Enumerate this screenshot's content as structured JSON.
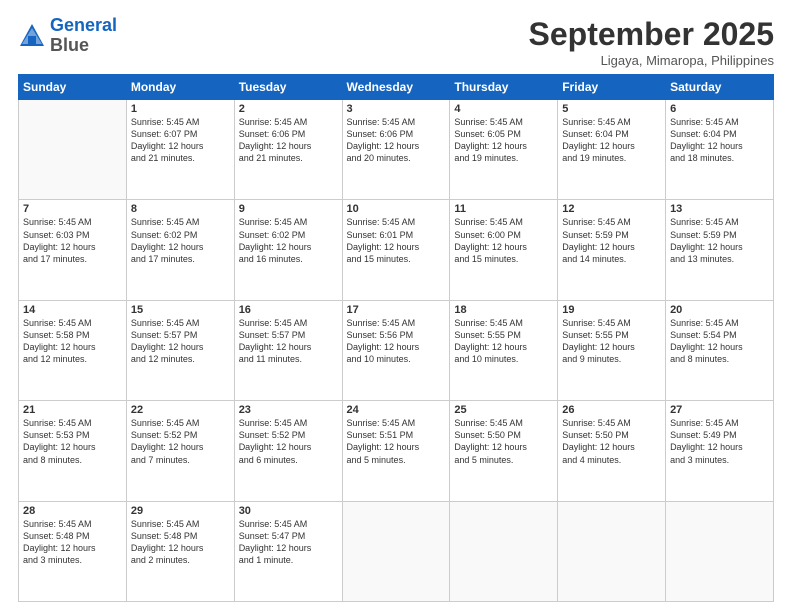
{
  "logo": {
    "line1": "General",
    "line2": "Blue"
  },
  "title": "September 2025",
  "location": "Ligaya, Mimaropa, Philippines",
  "days_of_week": [
    "Sunday",
    "Monday",
    "Tuesday",
    "Wednesday",
    "Thursday",
    "Friday",
    "Saturday"
  ],
  "weeks": [
    [
      {
        "day": "",
        "text": ""
      },
      {
        "day": "1",
        "text": "Sunrise: 5:45 AM\nSunset: 6:07 PM\nDaylight: 12 hours\nand 21 minutes."
      },
      {
        "day": "2",
        "text": "Sunrise: 5:45 AM\nSunset: 6:06 PM\nDaylight: 12 hours\nand 21 minutes."
      },
      {
        "day": "3",
        "text": "Sunrise: 5:45 AM\nSunset: 6:06 PM\nDaylight: 12 hours\nand 20 minutes."
      },
      {
        "day": "4",
        "text": "Sunrise: 5:45 AM\nSunset: 6:05 PM\nDaylight: 12 hours\nand 19 minutes."
      },
      {
        "day": "5",
        "text": "Sunrise: 5:45 AM\nSunset: 6:04 PM\nDaylight: 12 hours\nand 19 minutes."
      },
      {
        "day": "6",
        "text": "Sunrise: 5:45 AM\nSunset: 6:04 PM\nDaylight: 12 hours\nand 18 minutes."
      }
    ],
    [
      {
        "day": "7",
        "text": "Sunrise: 5:45 AM\nSunset: 6:03 PM\nDaylight: 12 hours\nand 17 minutes."
      },
      {
        "day": "8",
        "text": "Sunrise: 5:45 AM\nSunset: 6:02 PM\nDaylight: 12 hours\nand 17 minutes."
      },
      {
        "day": "9",
        "text": "Sunrise: 5:45 AM\nSunset: 6:02 PM\nDaylight: 12 hours\nand 16 minutes."
      },
      {
        "day": "10",
        "text": "Sunrise: 5:45 AM\nSunset: 6:01 PM\nDaylight: 12 hours\nand 15 minutes."
      },
      {
        "day": "11",
        "text": "Sunrise: 5:45 AM\nSunset: 6:00 PM\nDaylight: 12 hours\nand 15 minutes."
      },
      {
        "day": "12",
        "text": "Sunrise: 5:45 AM\nSunset: 5:59 PM\nDaylight: 12 hours\nand 14 minutes."
      },
      {
        "day": "13",
        "text": "Sunrise: 5:45 AM\nSunset: 5:59 PM\nDaylight: 12 hours\nand 13 minutes."
      }
    ],
    [
      {
        "day": "14",
        "text": "Sunrise: 5:45 AM\nSunset: 5:58 PM\nDaylight: 12 hours\nand 12 minutes."
      },
      {
        "day": "15",
        "text": "Sunrise: 5:45 AM\nSunset: 5:57 PM\nDaylight: 12 hours\nand 12 minutes."
      },
      {
        "day": "16",
        "text": "Sunrise: 5:45 AM\nSunset: 5:57 PM\nDaylight: 12 hours\nand 11 minutes."
      },
      {
        "day": "17",
        "text": "Sunrise: 5:45 AM\nSunset: 5:56 PM\nDaylight: 12 hours\nand 10 minutes."
      },
      {
        "day": "18",
        "text": "Sunrise: 5:45 AM\nSunset: 5:55 PM\nDaylight: 12 hours\nand 10 minutes."
      },
      {
        "day": "19",
        "text": "Sunrise: 5:45 AM\nSunset: 5:55 PM\nDaylight: 12 hours\nand 9 minutes."
      },
      {
        "day": "20",
        "text": "Sunrise: 5:45 AM\nSunset: 5:54 PM\nDaylight: 12 hours\nand 8 minutes."
      }
    ],
    [
      {
        "day": "21",
        "text": "Sunrise: 5:45 AM\nSunset: 5:53 PM\nDaylight: 12 hours\nand 8 minutes."
      },
      {
        "day": "22",
        "text": "Sunrise: 5:45 AM\nSunset: 5:52 PM\nDaylight: 12 hours\nand 7 minutes."
      },
      {
        "day": "23",
        "text": "Sunrise: 5:45 AM\nSunset: 5:52 PM\nDaylight: 12 hours\nand 6 minutes."
      },
      {
        "day": "24",
        "text": "Sunrise: 5:45 AM\nSunset: 5:51 PM\nDaylight: 12 hours\nand 5 minutes."
      },
      {
        "day": "25",
        "text": "Sunrise: 5:45 AM\nSunset: 5:50 PM\nDaylight: 12 hours\nand 5 minutes."
      },
      {
        "day": "26",
        "text": "Sunrise: 5:45 AM\nSunset: 5:50 PM\nDaylight: 12 hours\nand 4 minutes."
      },
      {
        "day": "27",
        "text": "Sunrise: 5:45 AM\nSunset: 5:49 PM\nDaylight: 12 hours\nand 3 minutes."
      }
    ],
    [
      {
        "day": "28",
        "text": "Sunrise: 5:45 AM\nSunset: 5:48 PM\nDaylight: 12 hours\nand 3 minutes."
      },
      {
        "day": "29",
        "text": "Sunrise: 5:45 AM\nSunset: 5:48 PM\nDaylight: 12 hours\nand 2 minutes."
      },
      {
        "day": "30",
        "text": "Sunrise: 5:45 AM\nSunset: 5:47 PM\nDaylight: 12 hours\nand 1 minute."
      },
      {
        "day": "",
        "text": ""
      },
      {
        "day": "",
        "text": ""
      },
      {
        "day": "",
        "text": ""
      },
      {
        "day": "",
        "text": ""
      }
    ]
  ]
}
